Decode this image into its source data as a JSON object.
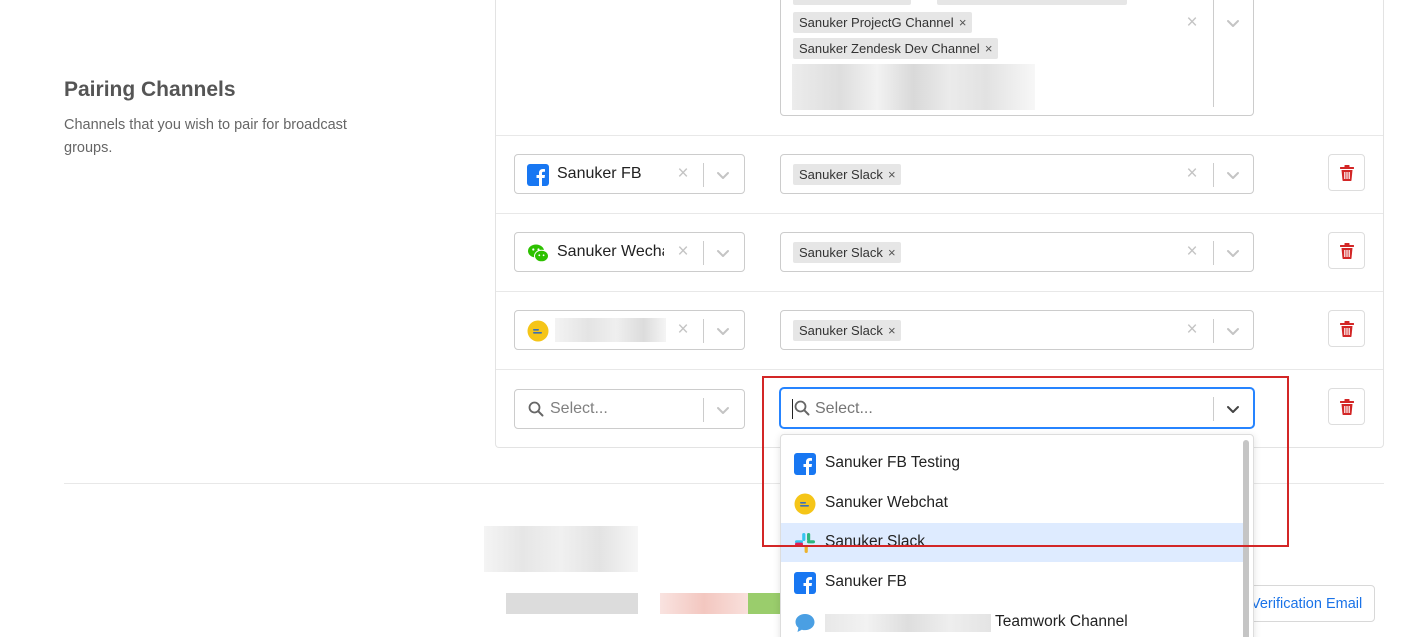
{
  "section": {
    "title": "Pairing Channels",
    "description": "Channels that you wish to pair for broadcast groups."
  },
  "top_row": {
    "tags": [
      "Sanuker ProjectG Channel",
      "Sanuker Zendesk Dev Channel"
    ]
  },
  "rows": [
    {
      "source": "Sanuker FB",
      "source_icon": "facebook-icon",
      "targets": [
        "Sanuker Slack"
      ]
    },
    {
      "source": "Sanuker Wecha",
      "source_icon": "wechat-icon",
      "targets": [
        "Sanuker Slack"
      ]
    },
    {
      "source": "",
      "source_icon": "webchat-icon",
      "targets": [
        "Sanuker Slack"
      ]
    }
  ],
  "new_row": {
    "source_placeholder": "Select...",
    "target_placeholder": "Select..."
  },
  "dropdown": {
    "options": [
      {
        "label": "Sanuker FB Testing",
        "icon": "facebook-icon"
      },
      {
        "label": "Sanuker Webchat",
        "icon": "webchat-icon"
      },
      {
        "label": "Sanuker Slack",
        "icon": "slack-icon",
        "highlighted": true
      },
      {
        "label": "Sanuker FB",
        "icon": "facebook-icon"
      },
      {
        "label": "Teamwork Channel",
        "icon": "chat-bubble-icon"
      }
    ]
  },
  "footer": {
    "verify_button_label": "Verification Email"
  },
  "colors": {
    "focus_blue": "#2684ff",
    "delete_red": "#d32626",
    "highlight_red": "#d32626",
    "facebook_blue": "#1877f2",
    "wechat_green": "#2dc100",
    "webchat_yellow": "#f5c518"
  }
}
